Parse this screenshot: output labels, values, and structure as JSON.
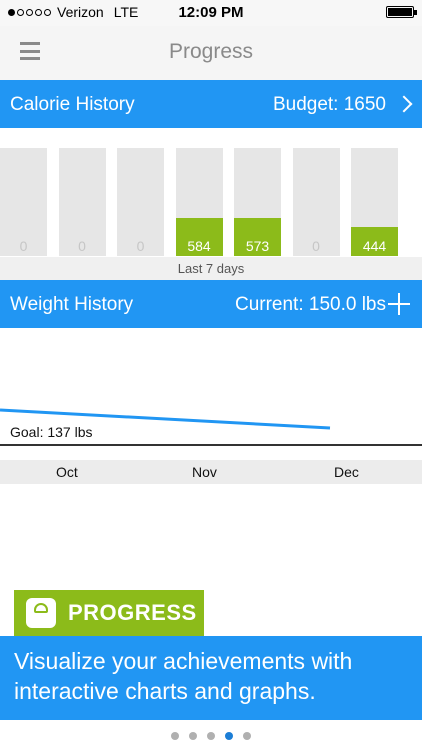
{
  "status_bar": {
    "carrier": "Verizon",
    "network": "LTE",
    "time": "12:09 PM",
    "signal_bars": 1
  },
  "nav": {
    "title": "Progress",
    "menu_icon": "hamburger-icon"
  },
  "calorie_history": {
    "title": "Calorie History",
    "budget_label": "Budget: 1650",
    "caption": "Last 7 days",
    "bars": [
      {
        "label": "0",
        "value": 0
      },
      {
        "label": "0",
        "value": 0
      },
      {
        "label": "0",
        "value": 0
      },
      {
        "label": "584",
        "value": 584
      },
      {
        "label": "573",
        "value": 573
      },
      {
        "label": "0",
        "value": 0
      },
      {
        "label": "444",
        "value": 444
      }
    ]
  },
  "weight_history": {
    "title": "Weight History",
    "current_label": "Current: 150.0 lbs",
    "goal_label": "Goal: 137 lbs",
    "months": [
      "Oct",
      "Nov",
      "Dec"
    ],
    "line_color": "#2196f3"
  },
  "promo": {
    "badge": "PROGRESS",
    "caption": "Visualize your achievements with interactive charts and graphs."
  },
  "pager": {
    "count": 5,
    "active": 3
  },
  "colors": {
    "accent": "#2196f3",
    "green": "#8cbb1a"
  }
}
